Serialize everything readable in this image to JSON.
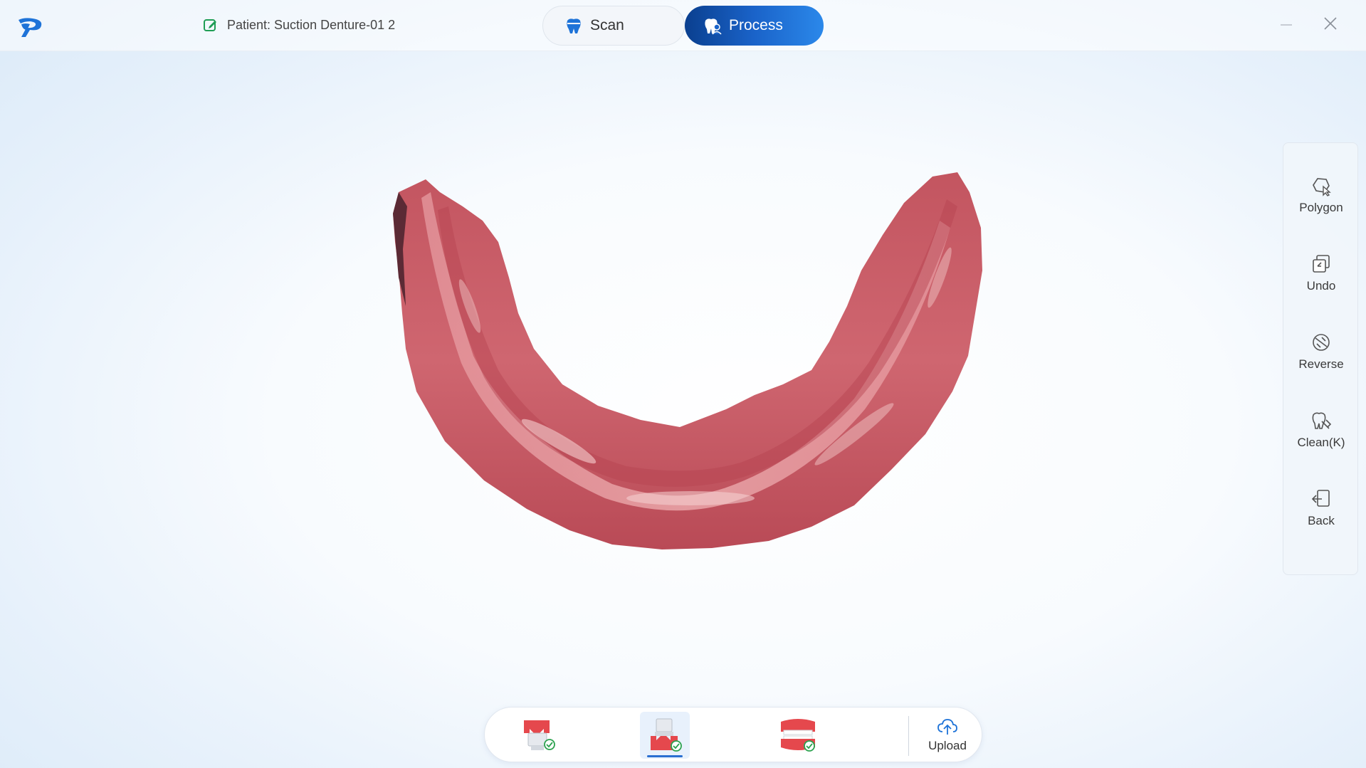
{
  "header": {
    "patient_label": "Patient: Suction Denture-01 2",
    "tabs": [
      {
        "label": "Scan",
        "icon": "tooth-icon",
        "active": false
      },
      {
        "label": "Process",
        "icon": "tooth-user-icon",
        "active": true
      }
    ],
    "accent_color": "#1a63c9"
  },
  "side_toolbar": {
    "items": [
      {
        "label": "Polygon",
        "icon": "polygon-select-icon"
      },
      {
        "label": "Undo",
        "icon": "undo-icon"
      },
      {
        "label": "Reverse",
        "icon": "reverse-icon"
      },
      {
        "label": "Clean(K)",
        "icon": "clean-tooth-icon"
      },
      {
        "label": "Back",
        "icon": "back-icon"
      }
    ]
  },
  "step_bar": {
    "steps": [
      {
        "icon": "upper-jaw-done-icon",
        "active": false
      },
      {
        "icon": "lower-jaw-done-icon",
        "active": true
      },
      {
        "icon": "bite-done-icon",
        "active": false
      }
    ],
    "upload_label": "Upload"
  },
  "viewport": {
    "model_color": "#c8545e"
  }
}
